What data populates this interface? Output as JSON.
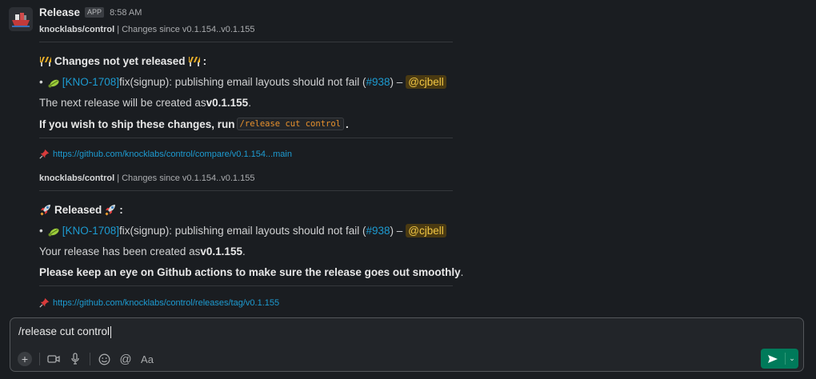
{
  "message": {
    "sender": "Release",
    "badge": "APP",
    "time": "8:58 AM",
    "blocks": [
      {
        "context_repo": "knocklabs/control",
        "context_text": " | Changes since v0.1.154..v0.1.155",
        "heading": "Changes not yet released",
        "heading_suffix": ":",
        "item_ticket": "[KNO-1708]",
        "item_text": " fix(signup): publishing email layouts should not fail  (",
        "item_pr": "#938",
        "item_after": ") – ",
        "item_mention": "@cjbell",
        "status_prefix": "The next release will be created as ",
        "status_version": "v0.1.155",
        "status_suffix": ".",
        "instruction_prefix": "If you wish to ship these changes, run ",
        "instruction_code": "/release cut control",
        "instruction_suffix": ".",
        "link": "https://github.com/knocklabs/control/compare/v0.1.154...main"
      },
      {
        "context_repo": "knocklabs/control",
        "context_text": " | Changes since v0.1.154..v0.1.155",
        "heading": "Released",
        "heading_suffix": ":",
        "item_ticket": "[KNO-1708]",
        "item_text": " fix(signup): publishing email layouts should not fail  (",
        "item_pr": "#938",
        "item_after": ") – ",
        "item_mention": "@cjbell",
        "status_prefix": "Your release has been created as ",
        "status_version": "v0.1.155",
        "status_suffix": ".",
        "instruction": "Please keep an eye on Github actions to make sure the release goes out smoothly",
        "instruction_suffix": ".",
        "link": "https://github.com/knocklabs/control/releases/tag/v0.1.155"
      }
    ]
  },
  "composer": {
    "text": "/release cut control"
  },
  "colors": {
    "background": "#1a1d21",
    "link": "#1d9bd1",
    "send": "#007a5a",
    "mention": "#f2c744"
  }
}
